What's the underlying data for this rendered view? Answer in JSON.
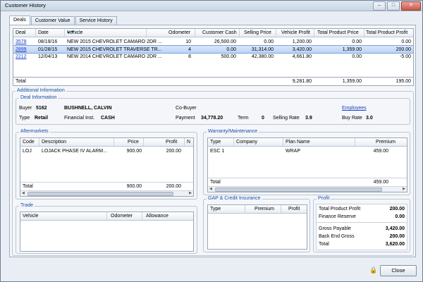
{
  "window": {
    "title": "Customer History"
  },
  "tabs": [
    {
      "label": "Deals"
    },
    {
      "label": "Customer Value"
    },
    {
      "label": "Service History"
    }
  ],
  "deals": {
    "columns": [
      "Deal",
      "Date",
      "Vehicle",
      "Odometer",
      "Customer Cash",
      "Selling Price",
      "Vehicle Profit",
      "Total Product Price",
      "Total Product Profit"
    ],
    "rows": [
      {
        "deal": "3578",
        "date": "08/19/16",
        "vehicle": "NEW 2015 CHEVROLET CAMARO 2DR ...",
        "odometer": "10",
        "cash": "26,500.00",
        "price": "0.00",
        "vprofit": "1,200.00",
        "tpp": "0.00",
        "tpprofit": "0.00"
      },
      {
        "deal": "2899",
        "date": "01/28/15",
        "vehicle": "NEW 2015 CHEVROLET TRAVERSE TR...",
        "odometer": "4",
        "cash": "0.00",
        "price": "31,314.00",
        "vprofit": "3,420.00",
        "tpp": "1,359.00",
        "tpprofit": "200.00"
      },
      {
        "deal": "2212",
        "date": "12/04/13",
        "vehicle": "NEW 2014 CHEVROLET CAMARO 2DR ...",
        "odometer": "8",
        "cash": "500.00",
        "price": "42,380.00",
        "vprofit": "4,661.80",
        "tpp": "0.00",
        "tpprofit": "-5.00"
      }
    ],
    "total_label": "Total",
    "totals": {
      "vprofit": "9,281.80",
      "tpp": "1,359.00",
      "tpprofit": "195.00"
    }
  },
  "additional": {
    "title": "Additional Information"
  },
  "deal_info": {
    "title": "Deal Information",
    "buyer_label": "Buyer",
    "buyer_id": "5162",
    "buyer_name": "BUSHNELL, CALVIN",
    "cobuyer_label": "Co-Buyer",
    "employees_link": "Employees",
    "type_label": "Type",
    "type_value": "Retail",
    "fin_label": "Financial Inst.",
    "fin_value": "CASH",
    "payment_label": "Payment",
    "payment_value": "34,778.20",
    "term_label": "Term",
    "term_value": "0",
    "srate_label": "Selling Rate",
    "srate_value": "3.9",
    "brate_label": "Buy Rate",
    "brate_value": "3.0"
  },
  "aftermarkets": {
    "title": "Aftermarkets",
    "columns": [
      "Code",
      "Description",
      "Price",
      "Profit",
      "N"
    ],
    "rows": [
      {
        "code": "LOJ",
        "desc": "LOJACK PHASE IV ALARM...",
        "price": "900.00",
        "profit": "200.00"
      }
    ],
    "total_label": "Total",
    "total_price": "900.00",
    "total_profit": "200.00"
  },
  "warranty": {
    "title": "Warranty/Maintenance",
    "columns": [
      "Type",
      "Company",
      "Plan Name",
      "Premium"
    ],
    "rows": [
      {
        "type": "ESC 1",
        "company": "",
        "plan": "WRAP",
        "premium": "459.00"
      }
    ],
    "total_label": "Total",
    "total_premium": "459.00"
  },
  "trade": {
    "title": "Trade",
    "columns": [
      "Vehicle",
      "Odometer",
      "Allowance"
    ]
  },
  "gap": {
    "title": "GAP & Credit Insurance",
    "columns": [
      "Type",
      "Premium",
      "Profit"
    ]
  },
  "profit": {
    "title": "Profit",
    "lines": [
      {
        "label": "Total Product Profit",
        "value": "200.00"
      },
      {
        "label": "Finance Reserve",
        "value": "0.00"
      },
      {
        "label": "Gross Payable",
        "value": "3,420.00"
      },
      {
        "label": "Back End Gross",
        "value": "200.00"
      },
      {
        "label": "Total",
        "value": "3,620.00"
      }
    ]
  },
  "footer": {
    "close_label": "Close",
    "lock_icon": "lock-icon"
  },
  "colors": {
    "selection": "#bcd4f5",
    "group_title": "#1b4fa8",
    "link": "#1a3fc4"
  }
}
